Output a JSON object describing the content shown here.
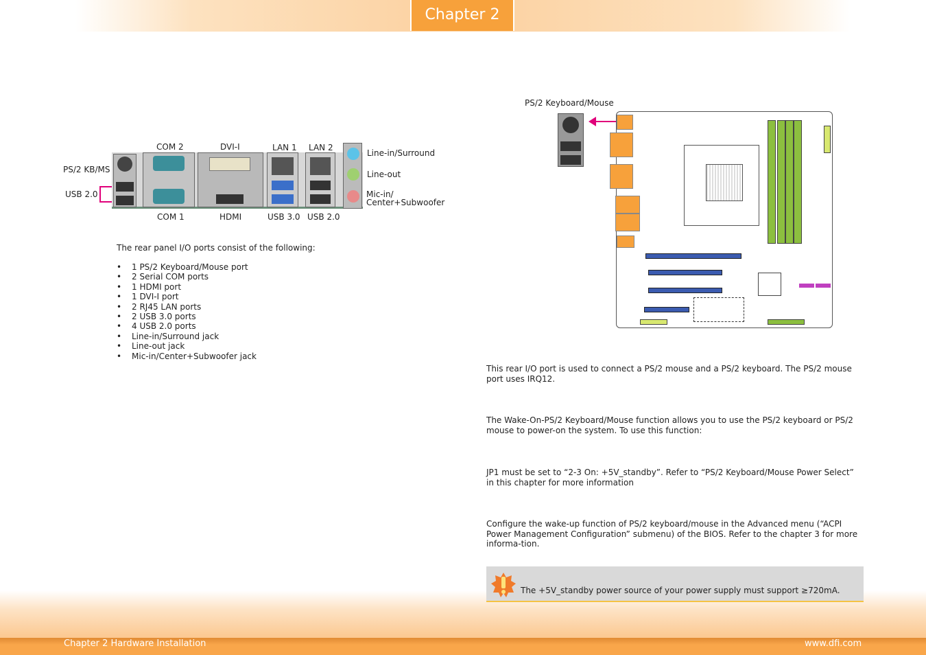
{
  "header": {
    "chapter_tab": "Chapter 2"
  },
  "io_panel": {
    "labels": {
      "ps2": "PS/2 KB/MS",
      "usb_left": "USB 2.0",
      "com2": "COM 2",
      "dvi": "DVI-I",
      "lan1": "LAN 1",
      "lan2": "LAN 2",
      "line_in": "Line-in/Surround",
      "line_out": "Line-out",
      "mic_in_1": "Mic-in/",
      "mic_in_2": "Center+Subwoofer",
      "com1": "COM 1",
      "hdmi": "HDMI",
      "usb30": "USB 3.0",
      "usb20": "USB 2.0"
    },
    "highlight_color": "#e0007a"
  },
  "intro": "The rear panel I/O ports consist of the following:",
  "ports_list": [
    "1 PS/2 Keyboard/Mouse port",
    "2 Serial COM ports",
    "1 HDMI port",
    "1 DVI-I port",
    "2 RJ45 LAN ports",
    "2 USB 3.0 ports",
    "4 USB 2.0 ports",
    "Line-in/Surround jack",
    "Line-out jack",
    "Mic-in/Center+Subwoofer jack"
  ],
  "board": {
    "label": "PS/2 Keyboard/Mouse",
    "arrow_color": "#e0007a"
  },
  "paragraphs": [
    "This rear I/O port is used to connect a PS/2 mouse and a PS/2 keyboard. The PS/2 mouse port uses IRQ12.",
    "The Wake-On-PS/2 Keyboard/Mouse function allows you to use the PS/2 keyboard or PS/2 mouse to power-on the system. To use this function:",
    "JP1 must be set to “2-3 On: +5V_standby”. Refer to “PS/2 Keyboard/Mouse Power Select” in this chapter for more information",
    "Configure the wake-up function of PS/2 keyboard/mouse in the Advanced menu (“ACPI Power Management Configuration” submenu) of the BIOS. Refer to the chapter 3 for more informa-tion."
  ],
  "note": {
    "icon": "warning-icon",
    "text": "The +5V_standby power source of your power supply must support ≥720mA."
  },
  "footer": {
    "left": "Chapter 2 Hardware Installation",
    "right": "www.dfi.com"
  },
  "colors": {
    "accent": "#f7a13b"
  }
}
